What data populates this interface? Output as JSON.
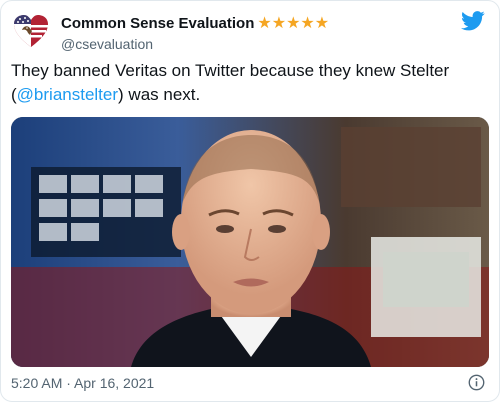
{
  "tweet": {
    "display_name": "Common Sense Evaluation",
    "stars": "★★★★★",
    "handle": "@csevaluation",
    "text_before": "They banned Veritas on Twitter because they knew Stelter (",
    "mention": "@brianstelter",
    "text_after": ") was next.",
    "timestamp": "5:20 AM · Apr 16, 2021"
  },
  "icons": {
    "avatar": "american-heart-eagle-icon",
    "brand": "twitter-bird-icon",
    "info": "info-icon"
  },
  "colors": {
    "link": "#1d9bf0",
    "twitter_blue": "#1d9bf0",
    "stars": "#f5a623",
    "secondary_text": "#536471"
  }
}
